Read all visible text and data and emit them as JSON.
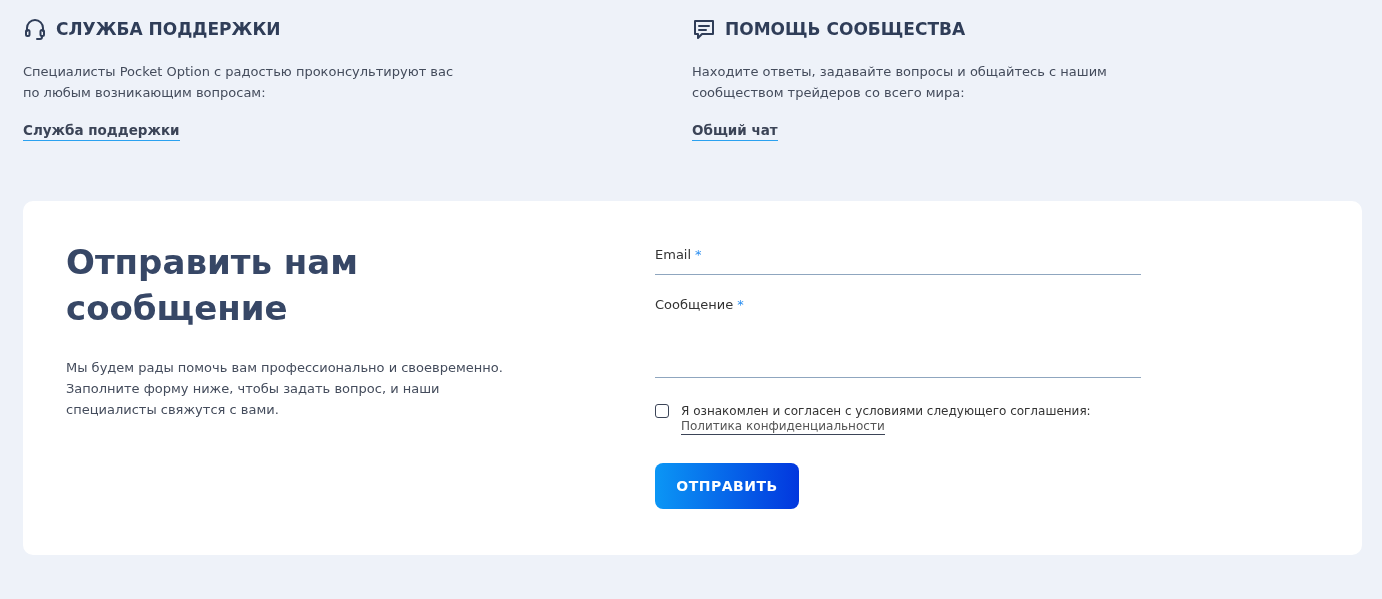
{
  "contacts": [
    {
      "kind": "headset",
      "title": "СЛУЖБА ПОДДЕРЖКИ",
      "text": "Специалисты Pocket Option с радостью проконсультируют вас по любым возникающим вопросам:",
      "link": "Служба поддержки"
    },
    {
      "kind": "chat",
      "title": "ПОМОЩЬ СООБЩЕСТВА",
      "text": "Находите ответы, задавайте вопросы и общайтесь с нашим сообществом трейдеров со всего мира:",
      "link": "Общий чат"
    }
  ],
  "form": {
    "title": "Отправить нам сообщение",
    "text": "Мы будем рады помочь вам профессионально и своевременно. Заполните форму ниже, чтобы задать вопрос, и наши специалисты свяжутся с вами.",
    "fields": [
      {
        "kind": "input",
        "label": "Email",
        "required_mark": "*"
      },
      {
        "kind": "textarea",
        "label": "Сообщение",
        "required_mark": "*"
      }
    ],
    "agreement": {
      "checked": false,
      "text": "Я ознакомлен и согласен с условиями следующего соглашения:",
      "link": "Политика конфиденциальности"
    },
    "submit": "ОТПРАВИТЬ"
  }
}
